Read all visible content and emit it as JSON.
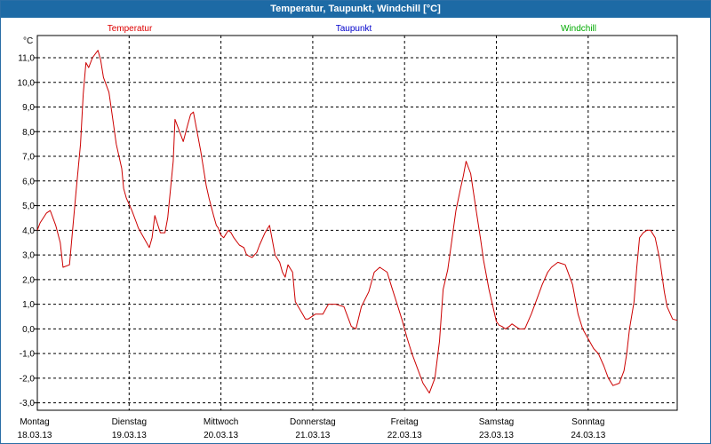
{
  "window": {
    "title": "Temperatur, Taupunkt, Windchill [°C]"
  },
  "chart_data": {
    "type": "line",
    "title": "Temperatur, Taupunkt, Windchill [°C]",
    "ylabel": "°C",
    "ylim": [
      -3.3,
      11.9
    ],
    "yticks": [
      11.0,
      10.0,
      9.0,
      8.0,
      7.0,
      6.0,
      5.0,
      4.0,
      3.0,
      2.0,
      1.0,
      0.0,
      -1.0,
      -2.0,
      -3.0
    ],
    "ytick_labels": [
      "11,0",
      "10,0",
      "9,0",
      "8,0",
      "7,0",
      "6,0",
      "5,0",
      "4,0",
      "3,0",
      "2,0",
      "1,0",
      "0,0",
      "-1,0",
      "-2,0",
      "-3,0"
    ],
    "xlim": [
      0,
      6.97
    ],
    "days": [
      {
        "day": "Montag",
        "date": "18.03.13"
      },
      {
        "day": "Dienstag",
        "date": "19.03.13"
      },
      {
        "day": "Mittwoch",
        "date": "20.03.13"
      },
      {
        "day": "Donnerstag",
        "date": "21.03.13"
      },
      {
        "day": "Freitag",
        "date": "22.03.13"
      },
      {
        "day": "Samstag",
        "date": "23.03.13"
      },
      {
        "day": "Sonntag",
        "date": "24.03.13"
      }
    ],
    "grid": true,
    "legend": [
      {
        "name": "Temperatur",
        "color": "#dd0000"
      },
      {
        "name": "Taupunkt",
        "color": "#0000cc"
      },
      {
        "name": "Windchill",
        "color": "#00aa00"
      }
    ],
    "series": [
      {
        "name": "Temperatur",
        "color": "#cc0000",
        "x": [
          0.0,
          0.03,
          0.1,
          0.14,
          0.2,
          0.25,
          0.28,
          0.35,
          0.42,
          0.47,
          0.5,
          0.53,
          0.56,
          0.6,
          0.66,
          0.69,
          0.72,
          0.78,
          0.83,
          0.86,
          0.92,
          0.94,
          0.97,
          1.03,
          1.08,
          1.1,
          1.16,
          1.22,
          1.25,
          1.28,
          1.34,
          1.39,
          1.42,
          1.48,
          1.5,
          1.53,
          1.56,
          1.59,
          1.64,
          1.67,
          1.7,
          1.73,
          1.78,
          1.81,
          1.84,
          1.87,
          1.92,
          1.95,
          1.97,
          2.0,
          2.03,
          2.08,
          2.11,
          2.14,
          2.2,
          2.25,
          2.28,
          2.34,
          2.39,
          2.42,
          2.48,
          2.53,
          2.56,
          2.59,
          2.64,
          2.67,
          2.7,
          2.73,
          2.78,
          2.81,
          2.89,
          2.92,
          2.95,
          3.03,
          3.11,
          3.17,
          3.2,
          3.25,
          3.34,
          3.42,
          3.47,
          3.53,
          3.61,
          3.67,
          3.73,
          3.81,
          3.86,
          3.92,
          3.97,
          4.03,
          4.08,
          4.14,
          4.2,
          4.27,
          4.33,
          4.38,
          4.42,
          4.47,
          4.56,
          4.61,
          4.64,
          4.67,
          4.72,
          4.78,
          4.83,
          4.86,
          4.92,
          5.0,
          5.03,
          5.06,
          5.1,
          5.14,
          5.17,
          5.25,
          5.31,
          5.38,
          5.45,
          5.5,
          5.56,
          5.6,
          5.67,
          5.75,
          5.83,
          5.89,
          5.94,
          6.0,
          6.06,
          6.11,
          6.17,
          6.22,
          6.27,
          6.34,
          6.39,
          6.42,
          6.45,
          6.5,
          6.53,
          6.56,
          6.6,
          6.64,
          6.68,
          6.73,
          6.78,
          6.83,
          6.86,
          6.92,
          6.97
        ],
        "values": [
          4.0,
          4.3,
          4.7,
          4.8,
          4.2,
          3.5,
          2.5,
          2.6,
          5.5,
          7.5,
          9.5,
          10.8,
          10.6,
          11.0,
          11.3,
          10.9,
          10.2,
          9.6,
          8.3,
          7.5,
          6.5,
          5.7,
          5.3,
          4.8,
          4.3,
          4.1,
          3.7,
          3.3,
          3.7,
          4.6,
          3.9,
          3.9,
          4.5,
          6.8,
          8.5,
          8.2,
          7.9,
          7.6,
          8.3,
          8.7,
          8.8,
          8.2,
          7.2,
          6.5,
          5.8,
          5.3,
          4.6,
          4.2,
          4.1,
          3.8,
          3.7,
          4.0,
          3.9,
          3.7,
          3.4,
          3.3,
          3.0,
          2.9,
          3.1,
          3.4,
          3.9,
          4.2,
          3.6,
          3.0,
          2.7,
          2.3,
          2.1,
          2.6,
          2.3,
          1.1,
          0.6,
          0.4,
          0.4,
          0.6,
          0.6,
          1.0,
          1.0,
          1.0,
          0.9,
          0.1,
          0.0,
          0.9,
          1.5,
          2.3,
          2.5,
          2.3,
          1.7,
          1.0,
          0.4,
          -0.4,
          -1.0,
          -1.6,
          -2.2,
          -2.6,
          -2.0,
          -0.5,
          1.6,
          2.4,
          4.8,
          5.7,
          6.2,
          6.8,
          6.3,
          4.8,
          3.6,
          2.8,
          1.6,
          0.3,
          0.15,
          0.1,
          0.0,
          0.1,
          0.2,
          0.0,
          0.0,
          0.6,
          1.3,
          1.8,
          2.3,
          2.5,
          2.7,
          2.6,
          1.8,
          0.6,
          0.0,
          -0.4,
          -0.8,
          -1.0,
          -1.5,
          -2.0,
          -2.3,
          -2.2,
          -1.7,
          -1.0,
          0.0,
          1.1,
          2.5,
          3.7,
          3.9,
          4.0,
          4.0,
          3.7,
          2.8,
          1.5,
          0.9,
          0.4,
          0.35
        ]
      }
    ]
  }
}
